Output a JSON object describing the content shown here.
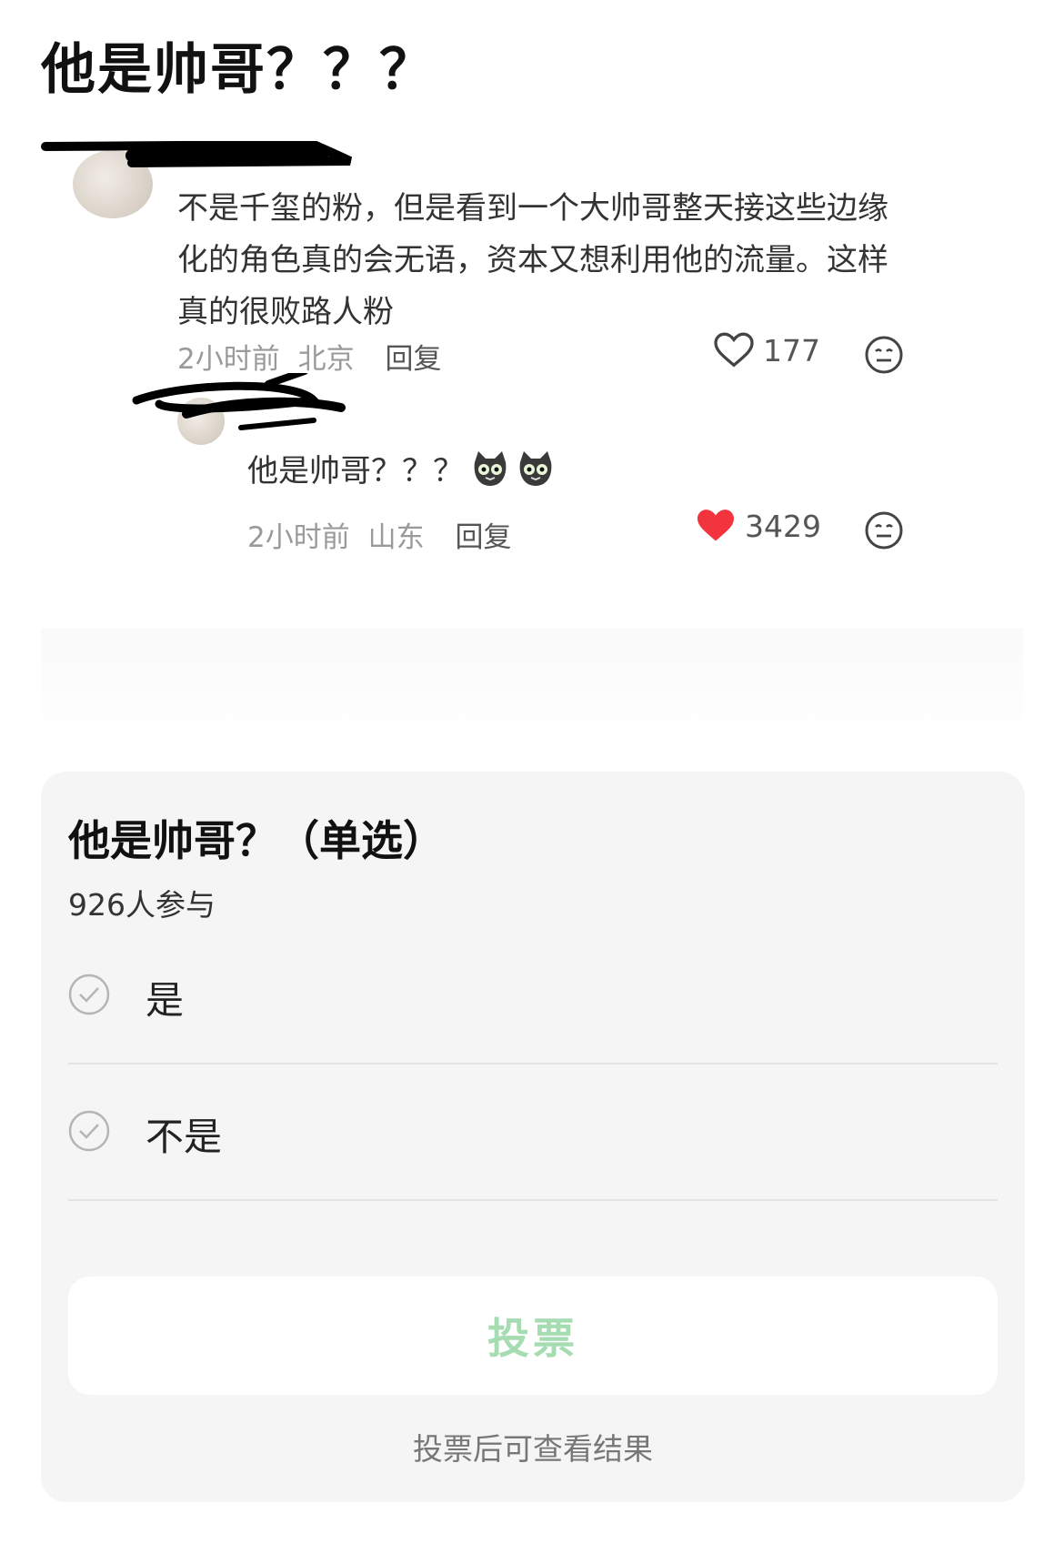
{
  "post": {
    "title": "他是帅哥？？？"
  },
  "comment": {
    "text": "不是千玺的粉，但是看到一个大帅哥整天接这些边缘化的角色真的会无语，资本又想利用他的流量。这样真的很败路人粉",
    "time": "2小时前",
    "location": "北京",
    "reply_label": "回复",
    "likes": "177",
    "liked": false
  },
  "reply": {
    "text": "他是帅哥？？？",
    "emoji": [
      "cat-face-icon",
      "cat-face-icon"
    ],
    "time": "2小时前",
    "location": "山东",
    "reply_label": "回复",
    "likes": "3429",
    "liked": true
  },
  "poll": {
    "title": "他是帅哥？（单选）",
    "participants": "926人参与",
    "options": [
      {
        "label": "是"
      },
      {
        "label": "不是"
      }
    ],
    "vote_label": "投票",
    "hint": "投票后可查看结果"
  },
  "colors": {
    "like_active": "#f2343f",
    "vote_text": "#a6dcb1",
    "poll_bg": "#f5f5f5"
  }
}
